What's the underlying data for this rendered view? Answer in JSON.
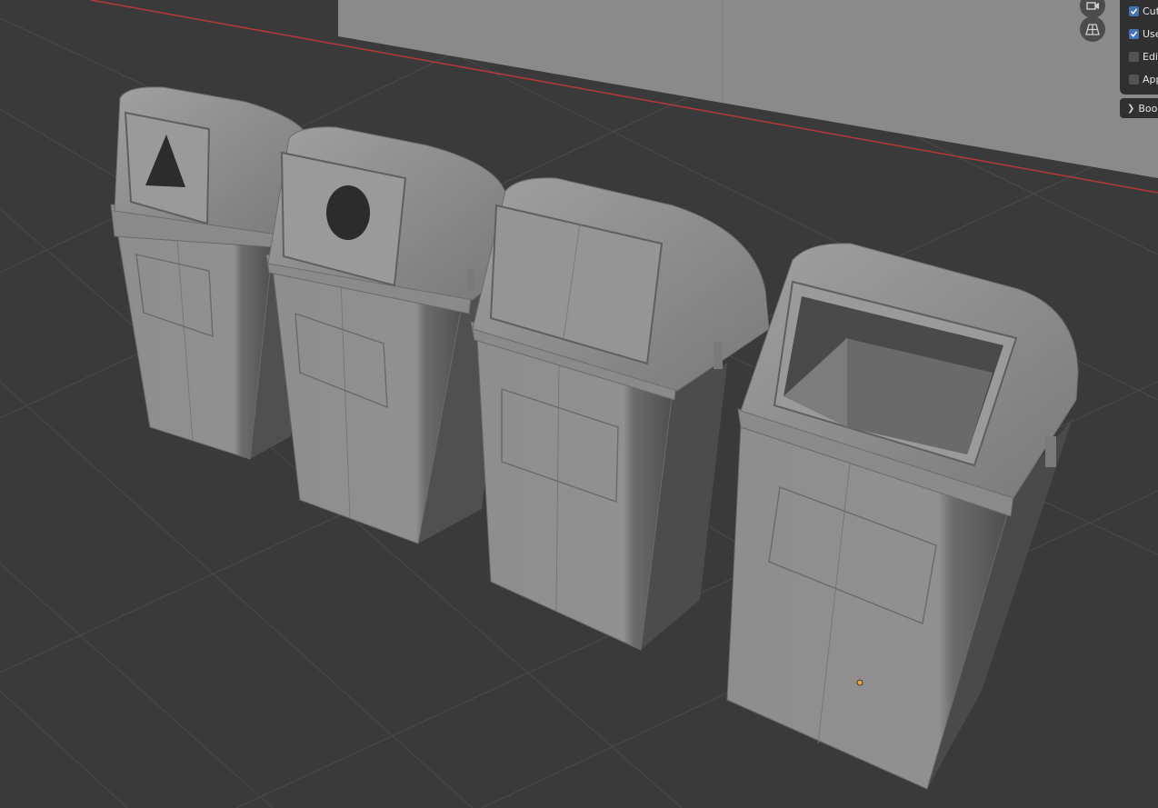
{
  "viewport": {
    "background": "#3a3a3a",
    "grid_color": "#4a4a4a",
    "x_axis_color": "#b8383b",
    "object_color": "#8c8c8c",
    "origin_color": "#e8a23a"
  },
  "nav_gizmo": {
    "camera_icon": "camera-icon",
    "grid_icon": "perspective-grid-icon"
  },
  "modifier_panel": {
    "options": [
      {
        "label": "Cut",
        "checked": true
      },
      {
        "label": "Use",
        "checked": true
      },
      {
        "label": "Edit",
        "checked": false
      },
      {
        "label": "App",
        "checked": false
      }
    ],
    "bool_header": "Boo"
  }
}
